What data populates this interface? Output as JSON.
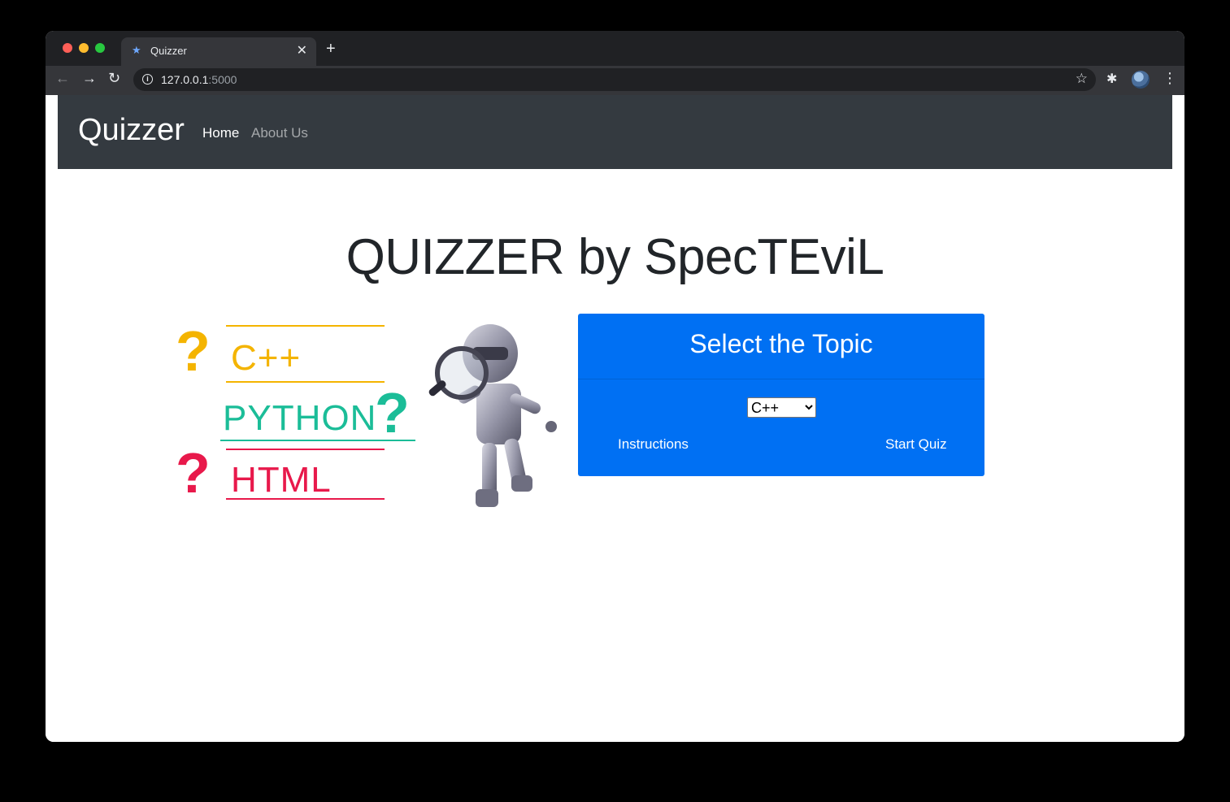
{
  "browser": {
    "tab_title": "Quizzer",
    "tab_favicon": "★",
    "new_tab_glyph": "+",
    "close_glyph": "✕",
    "url_host": "127.0.0.1",
    "url_port": ":5000",
    "icons": [
      "back-icon",
      "forward-icon",
      "reload-icon",
      "info-icon",
      "star-icon",
      "extensions-icon",
      "avatar",
      "menu-icon"
    ]
  },
  "navbar": {
    "brand": "Quizzer",
    "links": {
      "home": "Home",
      "about": "About Us"
    }
  },
  "main": {
    "headline": "QUIZZER by SpecTEviL",
    "hero": {
      "q1": "?",
      "t1": "C++",
      "q2": "?",
      "t2": "PYTHON",
      "q3": "?",
      "t3": "HTML",
      "colors": {
        "cpp": "#f4b400",
        "python": "#1bbd98",
        "html": "#e8194b"
      }
    },
    "card": {
      "title": "Select the Topic",
      "select_value": "C++",
      "options": [
        "C++"
      ],
      "instructions": "Instructions",
      "start": "Start Quiz",
      "color": "#0070f3"
    }
  }
}
